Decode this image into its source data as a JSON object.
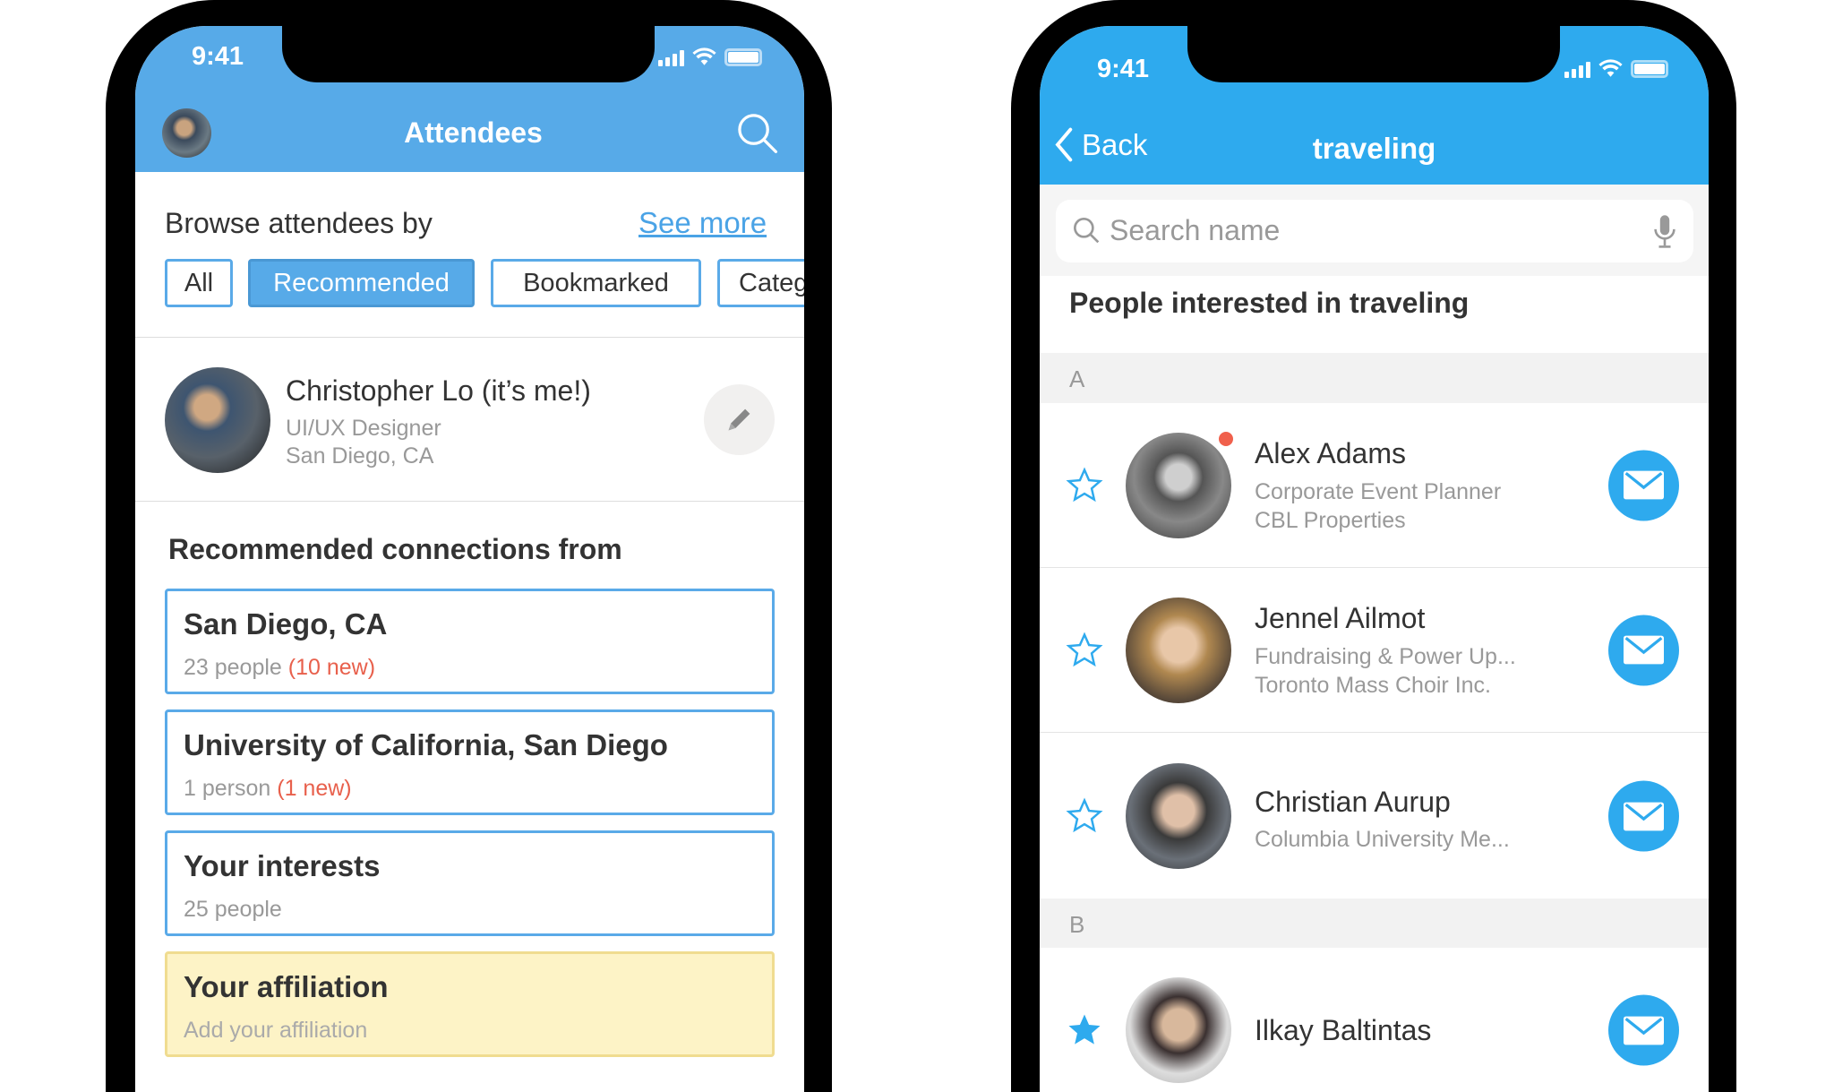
{
  "left_screen": {
    "status": {
      "time": "9:41"
    },
    "header": {
      "title": "Attendees",
      "color": "#57aae8",
      "search_icon": "search-icon"
    },
    "browse": {
      "label": "Browse attendees by",
      "see_more": "See more"
    },
    "chips": [
      {
        "label": "All",
        "active": false
      },
      {
        "label": "Recommended",
        "active": true
      },
      {
        "label": "Bookmarked",
        "active": false
      },
      {
        "label": "Categ",
        "active": false
      }
    ],
    "profile": {
      "name": "Christopher Lo (it’s me!)",
      "title": "UI/UX Designer",
      "location": "San Diego, CA",
      "edit_icon": "pencil-icon"
    },
    "recommended": {
      "heading": "Recommended connections from",
      "cards": [
        {
          "title": "San Diego, CA",
          "count": "23 people",
          "new": "(10 new)"
        },
        {
          "title": "University of California, San Diego",
          "count": "1 person",
          "new": "(1 new)"
        },
        {
          "title": "Your interests",
          "count": "25 people",
          "new": ""
        },
        {
          "title": "Your affiliation",
          "count": "Add your affiliation",
          "new": "",
          "highlight": true
        }
      ]
    }
  },
  "right_screen": {
    "status": {
      "time": "9:41"
    },
    "header": {
      "back": "Back",
      "title": "traveling",
      "color": "#2eaaee"
    },
    "search": {
      "placeholder": "Search name"
    },
    "heading": "People interested in traveling",
    "sections": [
      {
        "letter": "A",
        "people": [
          {
            "name": "Alex Adams",
            "line1": "Corporate Event Planner",
            "line2": "CBL Properties",
            "starred": false,
            "online_dot": true
          },
          {
            "name": "Jennel Ailmot",
            "line1": "Fundraising & Power Up...",
            "line2": "Toronto Mass Choir Inc.",
            "starred": false
          },
          {
            "name": "Christian Aurup",
            "line1": "Columbia University Me...",
            "line2": "",
            "starred": false
          }
        ]
      },
      {
        "letter": "B",
        "people": [
          {
            "name": "Ilkay Baltintas",
            "line1": "",
            "line2": "",
            "starred": true
          }
        ]
      }
    ]
  }
}
